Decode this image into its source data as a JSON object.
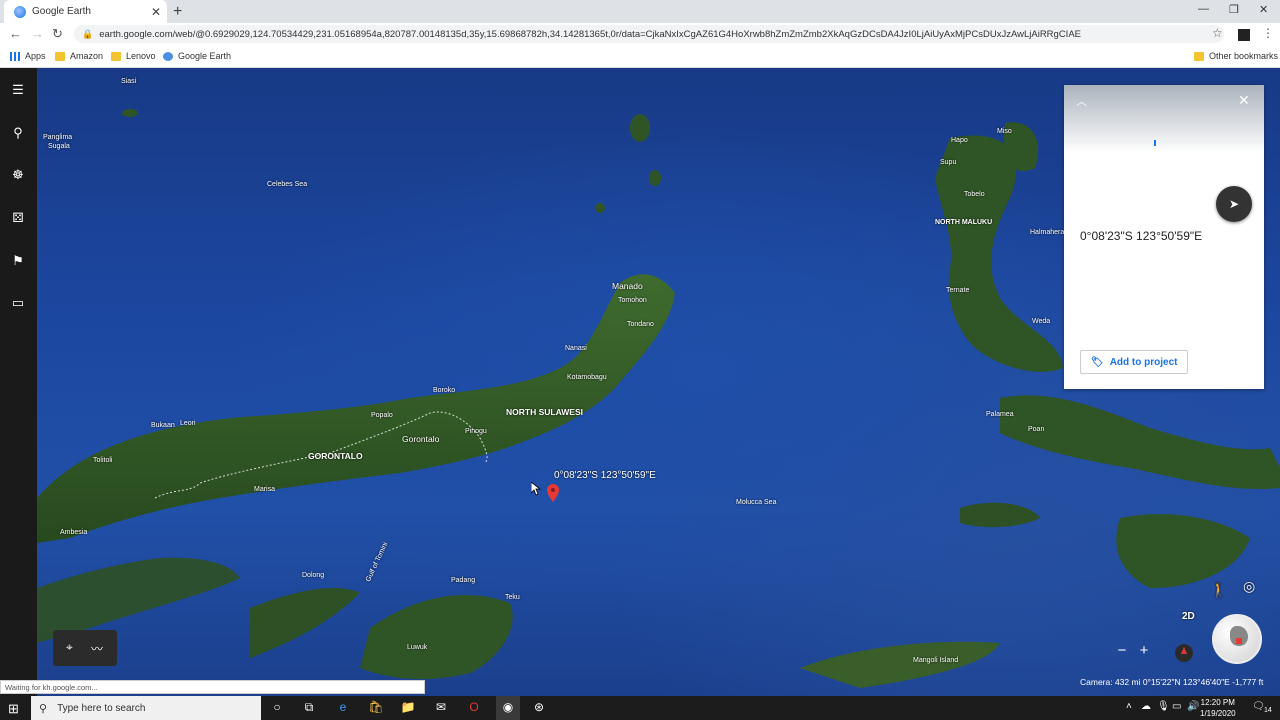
{
  "browser": {
    "tab_title": "Google Earth",
    "url": "earth.google.com/web/@0.6929029,124.70534429,231.05168954a,820787.00148135d,35y,15.69868782h,34.14281365t,0r/data=CjkaNxIxCgAZ61G4HoXrwb8hZmZmZmb2XkAqGzDCsDA4JzI0LjAiUyAxMjPCsDUxJzAwLjAiRRgCIAE",
    "bookmarks": [
      "Apps",
      "Amazon",
      "Lenovo",
      "Google Earth"
    ],
    "other_bookmarks": "Other bookmarks",
    "status": "Waiting for kh.google.com..."
  },
  "map": {
    "pin_label": "0°08'23\"S 123°50'59\"E",
    "places": {
      "siasi": "Siasi",
      "panglima": "Panglima",
      "sugala": "Sugala",
      "celebes_sea": "Celebes Sea",
      "manado": "Manado",
      "tomohon": "Tomohon",
      "tondano": "Tondano",
      "nanasi": "Nanasi",
      "kotamobagu": "Kotamobagu",
      "boroko": "Boroko",
      "popalo": "Popalo",
      "north_sulawesi": "NORTH SULAWESI",
      "pinogu": "Pinogu",
      "gorontalo_city": "Gorontalo",
      "gorontalo": "GORONTALO",
      "bukaan": "Bukaan",
      "leori": "Leori",
      "tolitoli": "Tolitoli",
      "marisa": "Marisa",
      "ambesia": "Ambesia",
      "dolong": "Dolong",
      "gulf_of_tomini": "Gulf of Tomini",
      "padang": "Padang",
      "teku": "Teku",
      "luwuk": "Luwuk",
      "molucca_sea": "Molucca Sea",
      "mangoli_island": "Mangoli Island",
      "hapo": "Hapo",
      "miso": "Miso",
      "supu": "Supu",
      "tobelo": "Tobelo",
      "north_maluku": "NORTH MALUKU",
      "halmahera": "Halmahera",
      "ternate": "Ternate",
      "weda": "Weda",
      "palamea": "Palamea",
      "poan": "Poan"
    },
    "view_toggle": "2D",
    "attribution": "Camera: 432 mi  0°15'22\"N 123°46'40\"E  -1,777 ft"
  },
  "card": {
    "coordinates": "0°08'23\"S 123°50'59\"E",
    "add_button": "Add to project"
  },
  "taskbar": {
    "search_placeholder": "Type here to search",
    "time": "12:20 PM",
    "date": "1/19/2020",
    "notifications": "14"
  }
}
